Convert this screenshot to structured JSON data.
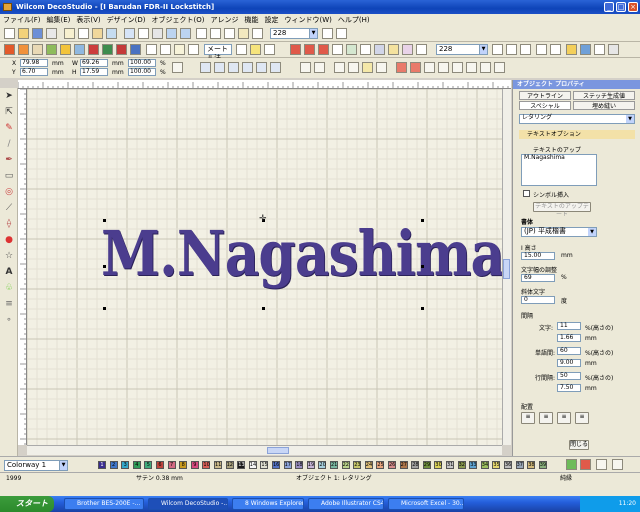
{
  "app": {
    "title": "Wilcom DecoStudio - [I          Barudan FDR-II Lockstitch]"
  },
  "menu": [
    "ファイル(F)",
    "編集(E)",
    "表示(V)",
    "デザイン(D)",
    "オブジェクト(O)",
    "アレンジ",
    "機能",
    "設定",
    "ウィンドウ(W)",
    "ヘルプ(H)"
  ],
  "toolbar": {
    "zoom1": "228",
    "zoom2": "228",
    "unit": "メートル法"
  },
  "coords": {
    "x_label": "X",
    "x_value": "79.98",
    "x_unit": "mm",
    "y_label": "Y",
    "y_value": "6.70",
    "y_unit": "mm",
    "w_label": "W",
    "w_value": "69.26",
    "w_unit": "mm",
    "h_label": "H",
    "h_value": "17.59",
    "h_unit": "mm",
    "sx_value": "100.00",
    "sx_unit": "%",
    "sy_value": "100.00",
    "sy_unit": "%"
  },
  "design_text": "M.Nagashima",
  "panel": {
    "title": "オブジェクト プロパティ",
    "tabs": [
      "アウトライン",
      "ステッチ生成値",
      "スペシャル",
      "埋め縫い"
    ],
    "type_select": "レタリング",
    "section": "テキストオプション",
    "text_label": "テキストのアップ",
    "text_value": "M.Nagashima",
    "symbol_insert": "シンボル挿入",
    "text_setup": "テキストのアップデート",
    "font_label": "書体",
    "font_value": "(JP) 平成楷書",
    "height_label": "I 高さ",
    "height_value": "15.00",
    "height_unit": "mm",
    "width_label": "文字幅の調整",
    "width_value": "69",
    "width_unit": "%",
    "italic_label": "斜体文字",
    "italic_value": "0",
    "italic_unit": "度",
    "spacing_label": "間隔",
    "char_label": "文字:",
    "char_value": "11",
    "char_unit": "%(高さの)",
    "char_mm_value": "1.66",
    "char_mm_unit": "mm",
    "word_label": "単語間:",
    "word_value": "60",
    "word_unit": "%(高さの)",
    "word_mm_value": "9.00",
    "word_mm_unit": "mm",
    "line_label": "行間隔:",
    "line_value": "50",
    "line_unit": "%(高さの)",
    "line_mm_value": "7.50",
    "line_mm_unit": "mm",
    "layout_label": "配置",
    "close": "閉じる"
  },
  "colorway": {
    "label": "Colorway 1",
    "swatches": [
      {
        "n": "1",
        "c": "#3a2d8f"
      },
      {
        "n": "2",
        "c": "#3f76c9"
      },
      {
        "n": "3",
        "c": "#34a7c9"
      },
      {
        "n": "4",
        "c": "#2f9a57"
      },
      {
        "n": "5",
        "c": "#3fa97a"
      },
      {
        "n": "6",
        "c": "#c0453d"
      },
      {
        "n": "7",
        "c": "#d36a84"
      },
      {
        "n": "8",
        "c": "#c99a1e"
      },
      {
        "n": "9",
        "c": "#d64a7f"
      },
      {
        "n": "10",
        "c": "#d85e57"
      },
      {
        "n": "11",
        "c": "#c9b88a"
      },
      {
        "n": "12",
        "c": "#a8a07d"
      },
      {
        "n": "13",
        "c": "#1a1a1a"
      },
      {
        "n": "14",
        "c": "#f5f5f5"
      },
      {
        "n": "15",
        "c": "#dfdfd0"
      },
      {
        "n": "16",
        "c": "#5472c4"
      },
      {
        "n": "17",
        "c": "#8da4d9"
      },
      {
        "n": "18",
        "c": "#9a8fc1"
      },
      {
        "n": "19",
        "c": "#c7b6d7"
      },
      {
        "n": "20",
        "c": "#a7cfdc"
      },
      {
        "n": "21",
        "c": "#7ab7a0"
      },
      {
        "n": "22",
        "c": "#b8d08b"
      },
      {
        "n": "23",
        "c": "#c5c56a"
      },
      {
        "n": "24",
        "c": "#e0c07a"
      },
      {
        "n": "25",
        "c": "#e7a57e"
      },
      {
        "n": "26",
        "c": "#d58c8c"
      },
      {
        "n": "27",
        "c": "#b1794c"
      },
      {
        "n": "28",
        "c": "#a0a0a0"
      },
      {
        "n": "29",
        "c": "#6f8f3d"
      },
      {
        "n": "30",
        "c": "#d8d05a"
      },
      {
        "n": "31",
        "c": "#c7c7c7"
      },
      {
        "n": "32",
        "c": "#8b9b4f"
      },
      {
        "n": "33",
        "c": "#5fa3d0"
      },
      {
        "n": "34",
        "c": "#9cbf5f"
      },
      {
        "n": "35",
        "c": "#e5d66e"
      },
      {
        "n": "36",
        "c": "#bcbcbc"
      },
      {
        "n": "37",
        "c": "#9aa8b8"
      },
      {
        "n": "38",
        "c": "#d2b97a"
      },
      {
        "n": "39",
        "c": "#8ab07d"
      }
    ]
  },
  "status": {
    "stitches": "1999",
    "size": "サテン  0.38 mm",
    "object": "オブジェクト 1: レタリング",
    "mode": "純縁"
  },
  "taskbar": {
    "start": "スタート",
    "tasks": [
      "Brother BES-200E -...",
      "Wilcom DecoStudio -...",
      "8 Windows Explorer",
      "Adobe Illustrator CS4...",
      "Microsoft Excel - 30..."
    ],
    "clock": "11:20"
  }
}
